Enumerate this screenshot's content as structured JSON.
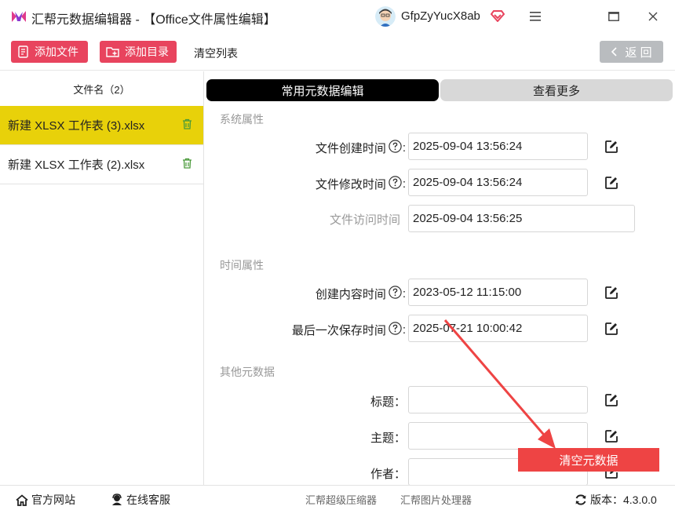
{
  "window": {
    "title": "汇帮元数据编辑器 - 【Office文件属性编辑】",
    "username": "GfpZyYucX8ab",
    "icons": [
      "app-logo-icon",
      "avatar-icon",
      "vip-diamond-icon",
      "menu-icon",
      "maximize-icon",
      "close-icon"
    ]
  },
  "toolbar": {
    "add_file_label": "添加文件",
    "add_dir_label": "添加目录",
    "clear_list_label": "清空列表",
    "back_label": "返 回"
  },
  "file_list": {
    "header": "文件名（2）",
    "items": [
      {
        "name": "新建 XLSX 工作表 (3).xlsx",
        "selected": true
      },
      {
        "name": "新建 XLSX 工作表 (2).xlsx",
        "selected": false
      }
    ]
  },
  "tabs": {
    "common": "常用元数据编辑",
    "more": "查看更多",
    "active": "common"
  },
  "sections": {
    "system": {
      "title": "系统属性",
      "fields": [
        {
          "label": "文件创建时间",
          "value": "2025-09-04 13:56:24",
          "editable": true
        },
        {
          "label": "文件修改时间",
          "value": "2025-09-04 13:56:24",
          "editable": true
        },
        {
          "label": "文件访问时间",
          "value": "2025-09-04 13:56:25",
          "editable": false
        }
      ]
    },
    "time": {
      "title": "时间属性",
      "fields": [
        {
          "label": "创建内容时间",
          "value": "2023-05-12 11:15:00",
          "editable": true
        },
        {
          "label": "最后一次保存时间",
          "value": "2025-07-21 10:00:42",
          "editable": true
        }
      ]
    },
    "other": {
      "title": "其他元数据",
      "fields": [
        {
          "label": "标题",
          "value": "",
          "editable": true
        },
        {
          "label": "主题",
          "value": "",
          "editable": true
        },
        {
          "label": "作者",
          "value": "",
          "editable": true
        }
      ]
    }
  },
  "clear_metadata_label": "清空元数据",
  "statusbar": {
    "website": "官方网站",
    "support": "在线客服",
    "compressor": "汇帮超级压缩器",
    "image_tool": "汇帮图片处理器",
    "version": "版本：4.3.0.0"
  },
  "colors": {
    "accent_pink": "#e8445e",
    "selected_row": "#e8d10a",
    "clear_button": "#ee4444",
    "annotation_arrow": "#ee4444"
  }
}
